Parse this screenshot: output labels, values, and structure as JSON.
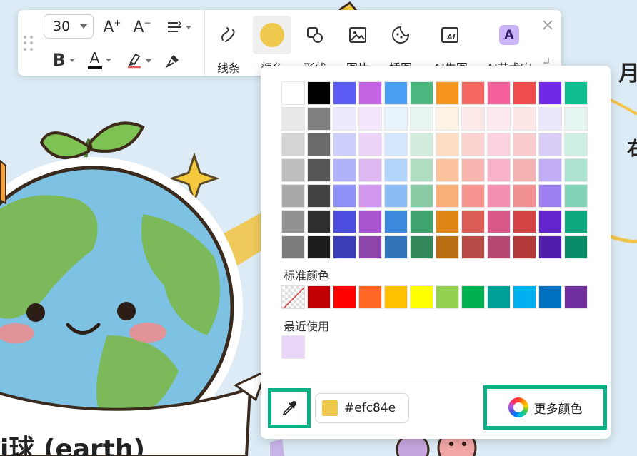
{
  "background": {
    "earth_label_fragment": "i球 (earth)",
    "right_text_1": "月",
    "right_text_2": "右"
  },
  "toolbar": {
    "font_size": "30",
    "increase_font_label": "A",
    "decrease_font_label": "A",
    "bold_label": "B",
    "font_color_label": "A",
    "tools": [
      {
        "label": "线条",
        "icon": "line-tool-icon"
      },
      {
        "label": "颜色",
        "icon": "color-tool-icon"
      },
      {
        "label": "形状",
        "icon": "shape-tool-icon"
      },
      {
        "label": "图片",
        "icon": "image-tool-icon"
      },
      {
        "label": "插图",
        "icon": "sticker-tool-icon"
      },
      {
        "label": "AI生图",
        "icon": "ai-image-tool-icon"
      },
      {
        "label": "AI艺术字",
        "icon": "ai-wordart-tool-icon"
      }
    ]
  },
  "color_panel": {
    "theme_grid": [
      [
        "#ffffff",
        "#000000",
        "#5a5cf4",
        "#c463e4",
        "#4a9ef3",
        "#4ab77e",
        "#f6951b",
        "#f56761",
        "#f4619a",
        "#ef4d4d",
        "#7129e8",
        "#0fbf8f"
      ],
      [
        "#e9e9e9",
        "#7f7f7f",
        "#ebebfd",
        "#f5e7fb",
        "#e8f2fd",
        "#e8f5ee",
        "#fef1e6",
        "#fde9e8",
        "#fde8f0",
        "#fce6e6",
        "#ede7fc",
        "#e6f7f1"
      ],
      [
        "#d4d4d4",
        "#6a6a6a",
        "#cecefb",
        "#ebd2f6",
        "#d3e6fb",
        "#d1ebdd",
        "#fcdcc2",
        "#fbd2cf",
        "#fbd0df",
        "#f9cdcd",
        "#d9cdf8",
        "#cdeee3"
      ],
      [
        "#bebebe",
        "#565656",
        "#b1b2f8",
        "#deb8f1",
        "#b3d4f9",
        "#b0dcc2",
        "#fac39e",
        "#f8b6b2",
        "#f8b3c9",
        "#f4b2b2",
        "#c1aef5",
        "#ade2d0"
      ],
      [
        "#a8a8a8",
        "#434343",
        "#8f91f6",
        "#d197ec",
        "#8cbcf6",
        "#89cba4",
        "#f8b077",
        "#f6958f",
        "#f58fb1",
        "#f08f8f",
        "#9c80f0",
        "#80d3b6"
      ],
      [
        "#929292",
        "#2f2f2f",
        "#4b4ddf",
        "#a954cf",
        "#3d88dd",
        "#3ea36d",
        "#de8515",
        "#dc5c56",
        "#da5789",
        "#d54545",
        "#6224cf",
        "#0ea97f"
      ],
      [
        "#7c7c7c",
        "#1c1c1c",
        "#3c3eb8",
        "#8d45ac",
        "#3173b8",
        "#32885b",
        "#b86e11",
        "#b74c47",
        "#b54872",
        "#b13939",
        "#511eac",
        "#0b8c69"
      ]
    ],
    "standard_title": "标准颜色",
    "standard_colors": [
      "#c00000",
      "#ff0000",
      "#ff6724",
      "#ffc000",
      "#ffff00",
      "#92d050",
      "#00b050",
      "#009e96",
      "#00b0f0",
      "#0070c0",
      "#7030a0"
    ],
    "recent_title": "最近使用",
    "recent_colors": [
      "#ead6f7"
    ],
    "hex_value": "#efc84e",
    "more_colors_label": "更多颜色",
    "accent_color": "#0bb085"
  }
}
